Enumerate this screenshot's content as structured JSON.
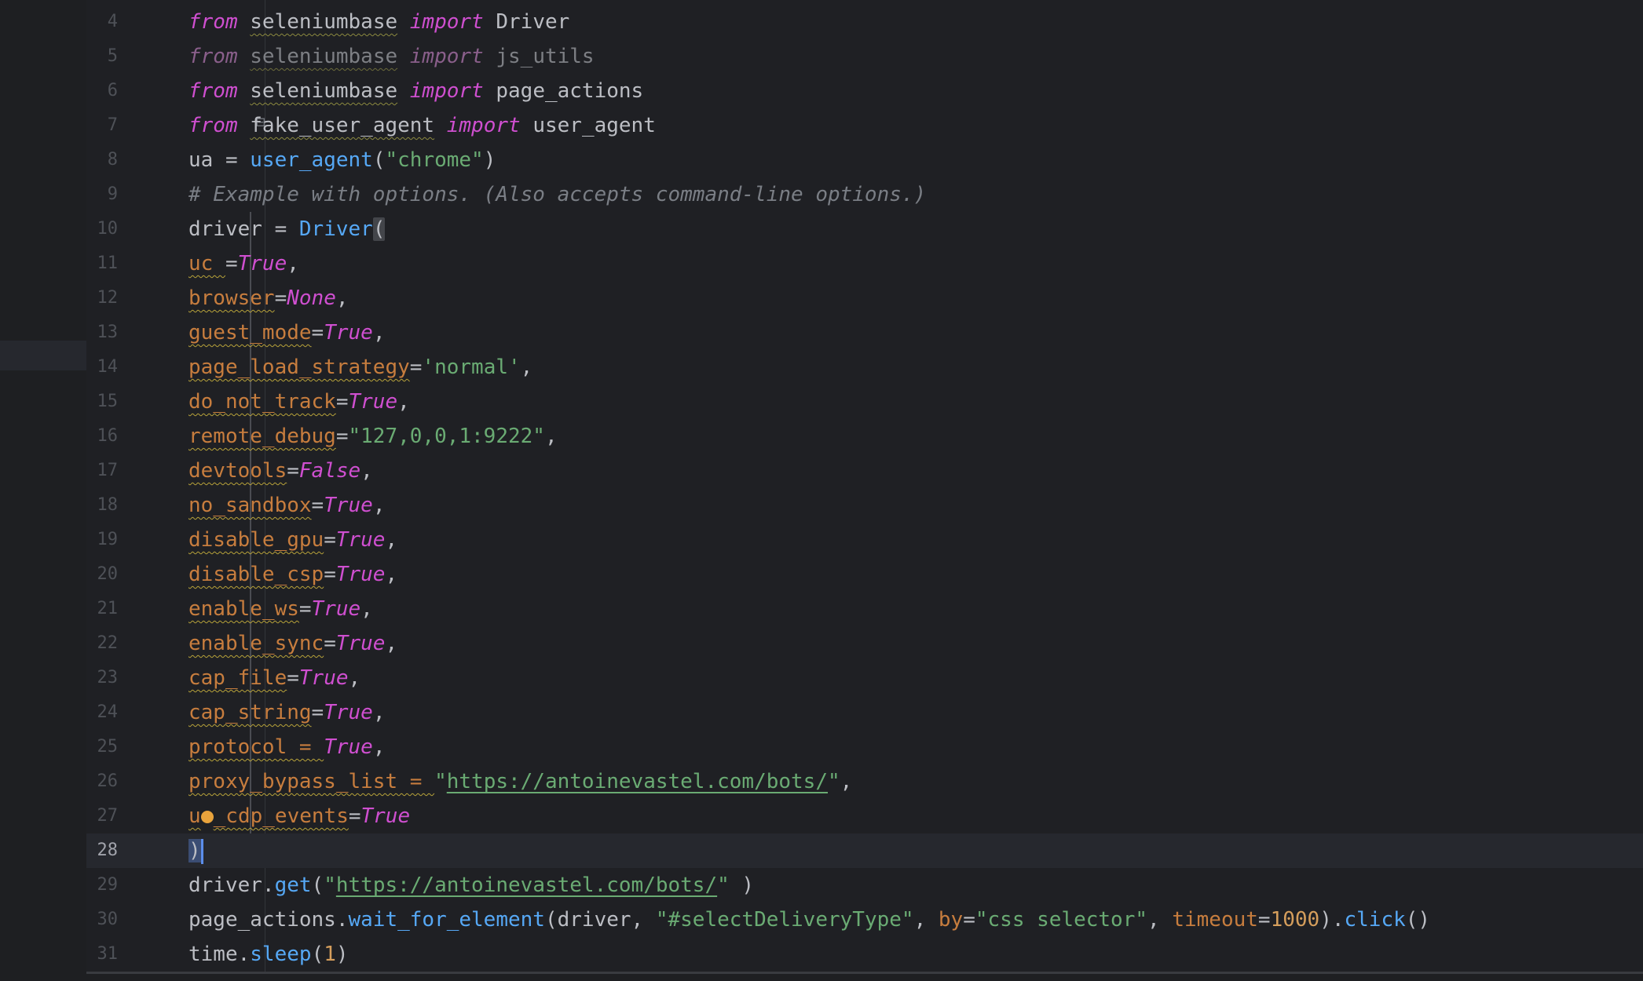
{
  "editor": {
    "current_line": 28,
    "lines": [
      {
        "n": "4",
        "tokens": [
          [
            "kw",
            "from"
          ],
          [
            "id",
            " "
          ],
          [
            "mod",
            "seleniumbase"
          ],
          [
            "id",
            " "
          ],
          [
            "kw",
            "import"
          ],
          [
            "id",
            " Driver"
          ]
        ]
      },
      {
        "n": "5",
        "tokens": [
          [
            "kwdim",
            "from"
          ],
          [
            "iddim",
            " "
          ],
          [
            "moddim",
            "seleniumbase"
          ],
          [
            "iddim",
            " "
          ],
          [
            "kwdim",
            "import"
          ],
          [
            "iddim",
            " js_utils"
          ]
        ]
      },
      {
        "n": "6",
        "tokens": [
          [
            "kw",
            "from"
          ],
          [
            "id",
            " "
          ],
          [
            "mod",
            "seleniumbase"
          ],
          [
            "id",
            " "
          ],
          [
            "kw",
            "import"
          ],
          [
            "id",
            " page_actions"
          ]
        ]
      },
      {
        "n": "7",
        "tokens": [
          [
            "kw",
            "from"
          ],
          [
            "id",
            " "
          ],
          [
            "mod",
            "fake_user_agent"
          ],
          [
            "id",
            " "
          ],
          [
            "kw",
            "import"
          ],
          [
            "id",
            " user_agent"
          ]
        ]
      },
      {
        "n": "8",
        "tokens": [
          [
            "id",
            "ua = "
          ],
          [
            "fn",
            "user_agent"
          ],
          [
            "punc",
            "("
          ],
          [
            "str",
            "\"chrome\""
          ],
          [
            "punc",
            ")"
          ]
        ]
      },
      {
        "n": "9",
        "tokens": [
          [
            "cmt",
            "# Example with options. (Also accepts command-line options.)"
          ]
        ]
      },
      {
        "n": "10",
        "tokens": [
          [
            "id",
            "driver = "
          ],
          [
            "fn",
            "Driver"
          ],
          [
            "bracket-hl",
            "("
          ]
        ]
      },
      {
        "n": "11",
        "tokens": [
          [
            "param",
            "uc "
          ],
          [
            "punc",
            "="
          ],
          [
            "kw",
            "True"
          ],
          [
            "punc",
            ","
          ]
        ]
      },
      {
        "n": "12",
        "tokens": [
          [
            "param",
            "browser"
          ],
          [
            "punc",
            "="
          ],
          [
            "kw",
            "None"
          ],
          [
            "punc",
            ","
          ]
        ]
      },
      {
        "n": "13",
        "tokens": [
          [
            "param",
            "guest_mode"
          ],
          [
            "punc",
            "="
          ],
          [
            "kw",
            "True"
          ],
          [
            "punc",
            ","
          ]
        ]
      },
      {
        "n": "14",
        "tokens": [
          [
            "param",
            "page_load_strategy"
          ],
          [
            "punc",
            "="
          ],
          [
            "str",
            "'normal'"
          ],
          [
            "punc",
            ","
          ]
        ]
      },
      {
        "n": "15",
        "tokens": [
          [
            "param",
            "do_not_track"
          ],
          [
            "punc",
            "="
          ],
          [
            "kw",
            "True"
          ],
          [
            "punc",
            ","
          ]
        ]
      },
      {
        "n": "16",
        "tokens": [
          [
            "param",
            "remote_debug"
          ],
          [
            "punc",
            "="
          ],
          [
            "str",
            "\"127,0,0,1:9222\""
          ],
          [
            "punc",
            ","
          ]
        ]
      },
      {
        "n": "17",
        "tokens": [
          [
            "param",
            "devtools"
          ],
          [
            "punc",
            "="
          ],
          [
            "kw",
            "False"
          ],
          [
            "punc",
            ","
          ]
        ]
      },
      {
        "n": "18",
        "tokens": [
          [
            "param",
            "no_sandbox"
          ],
          [
            "punc",
            "="
          ],
          [
            "kw",
            "True"
          ],
          [
            "punc",
            ","
          ]
        ]
      },
      {
        "n": "19",
        "tokens": [
          [
            "param",
            "disable_gpu"
          ],
          [
            "punc",
            "="
          ],
          [
            "kw",
            "True"
          ],
          [
            "punc",
            ","
          ]
        ]
      },
      {
        "n": "20",
        "tokens": [
          [
            "param",
            "disable_csp"
          ],
          [
            "punc",
            "="
          ],
          [
            "kw",
            "True"
          ],
          [
            "punc",
            ","
          ]
        ]
      },
      {
        "n": "21",
        "tokens": [
          [
            "param",
            "enable_ws"
          ],
          [
            "punc",
            "="
          ],
          [
            "kw",
            "True"
          ],
          [
            "punc",
            ","
          ]
        ]
      },
      {
        "n": "22",
        "tokens": [
          [
            "param",
            "enable_sync"
          ],
          [
            "punc",
            "="
          ],
          [
            "kw",
            "True"
          ],
          [
            "punc",
            ","
          ]
        ]
      },
      {
        "n": "23",
        "tokens": [
          [
            "param",
            "cap_file"
          ],
          [
            "punc",
            "="
          ],
          [
            "kw",
            "True"
          ],
          [
            "punc",
            ","
          ]
        ]
      },
      {
        "n": "24",
        "tokens": [
          [
            "param",
            "cap_string"
          ],
          [
            "punc",
            "="
          ],
          [
            "kw",
            "True"
          ],
          [
            "punc",
            ","
          ]
        ]
      },
      {
        "n": "25",
        "tokens": [
          [
            "param",
            "protocol = "
          ],
          [
            "kw",
            "True"
          ],
          [
            "punc",
            ","
          ]
        ]
      },
      {
        "n": "26",
        "tokens": [
          [
            "param",
            "proxy_bypass_list = "
          ],
          [
            "str",
            "\""
          ],
          [
            "url",
            "https://antoinevastel.com/bots/"
          ],
          [
            "str",
            "\""
          ],
          [
            "punc",
            ","
          ]
        ]
      },
      {
        "n": "27",
        "tokens": [
          [
            "param",
            "u"
          ],
          [
            "bulb",
            ""
          ],
          [
            "param",
            "_cdp_events"
          ],
          [
            "punc",
            "="
          ],
          [
            "kw",
            "True"
          ]
        ]
      },
      {
        "n": "28",
        "tokens": [
          [
            "bracket-sel",
            ")"
          ],
          [
            "caret",
            ""
          ]
        ]
      },
      {
        "n": "29",
        "tokens": [
          [
            "id",
            "driver."
          ],
          [
            "fn",
            "get"
          ],
          [
            "punc",
            "("
          ],
          [
            "str",
            "\""
          ],
          [
            "url",
            "https://antoinevastel.com/bots/"
          ],
          [
            "str",
            "\""
          ],
          [
            "punc",
            " )"
          ]
        ]
      },
      {
        "n": "30",
        "tokens": [
          [
            "id",
            "page_actions."
          ],
          [
            "fn",
            "wait_for_element"
          ],
          [
            "punc",
            "(driver, "
          ],
          [
            "str",
            "\"#selectDeliveryType\""
          ],
          [
            "punc",
            ", "
          ],
          [
            "kwarg",
            "by"
          ],
          [
            "punc",
            "="
          ],
          [
            "str",
            "\"css selector\""
          ],
          [
            "punc",
            ", "
          ],
          [
            "kwarg",
            "timeout"
          ],
          [
            "punc",
            "="
          ],
          [
            "numo",
            "1000"
          ],
          [
            "punc",
            ")."
          ],
          [
            "fn",
            "click"
          ],
          [
            "punc",
            "()"
          ]
        ]
      },
      {
        "n": "31",
        "tokens": [
          [
            "id",
            "time."
          ],
          [
            "fn",
            "sleep"
          ],
          [
            "punc",
            "("
          ],
          [
            "numo",
            "1"
          ],
          [
            "punc",
            ")"
          ]
        ]
      }
    ]
  }
}
